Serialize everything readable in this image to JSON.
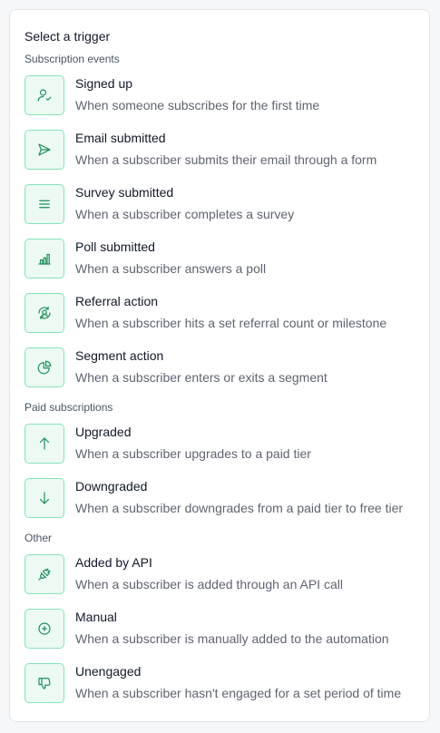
{
  "title": "Select a trigger",
  "accent_color": "#1f8d5c",
  "icon_bg_color": "#ecfaf3",
  "icon_border_color": "#86e3b9",
  "sections": [
    {
      "label": "Subscription events",
      "items": [
        {
          "icon": "user-check-icon",
          "title": "Signed up",
          "desc": "When someone subscribes for the first time"
        },
        {
          "icon": "send-icon",
          "title": "Email submitted",
          "desc": "When a subscriber submits their email through a form"
        },
        {
          "icon": "list-icon",
          "title": "Survey submitted",
          "desc": "When a subscriber completes a survey"
        },
        {
          "icon": "bar-chart-icon",
          "title": "Poll submitted",
          "desc": "When a subscriber answers a poll"
        },
        {
          "icon": "referral-icon",
          "title": "Referral action",
          "desc": "When a subscriber hits a set referral count or milestone"
        },
        {
          "icon": "pie-chart-icon",
          "title": "Segment action",
          "desc": "When a subscriber enters or exits a segment"
        }
      ]
    },
    {
      "label": "Paid subscriptions",
      "items": [
        {
          "icon": "arrow-up-icon",
          "title": "Upgraded",
          "desc": "When a subscriber upgrades to a paid tier"
        },
        {
          "icon": "arrow-down-icon",
          "title": "Downgraded",
          "desc": "When a subscriber downgrades from a paid tier to free tier"
        }
      ]
    },
    {
      "label": "Other",
      "items": [
        {
          "icon": "plug-icon",
          "title": "Added by API",
          "desc": "When a subscriber is added through an API call"
        },
        {
          "icon": "plus-circle-icon",
          "title": "Manual",
          "desc": "When a subscriber is manually added to the automation"
        },
        {
          "icon": "thumbs-down-icon",
          "title": "Unengaged",
          "desc": "When a subscriber hasn't engaged for a set period of time"
        }
      ]
    }
  ]
}
